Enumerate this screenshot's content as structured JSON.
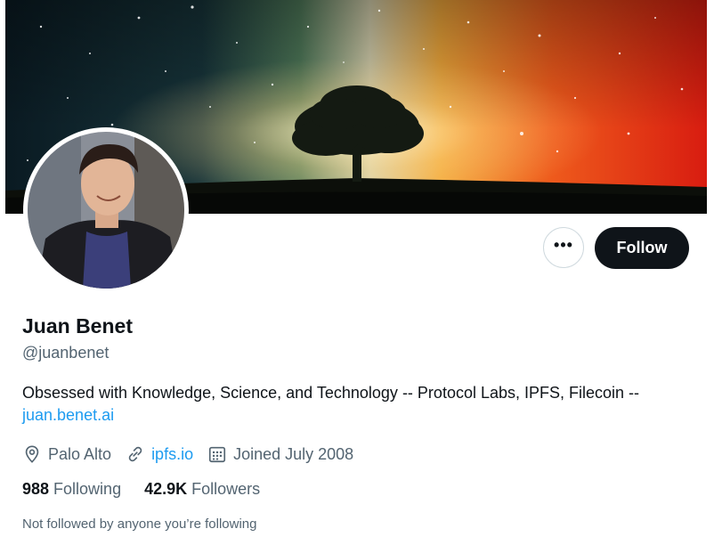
{
  "profile": {
    "name": "Juan Benet",
    "handle": "@juanbenet",
    "bio_text": "Obsessed with Knowledge, Science, and Technology -- Protocol Labs, IPFS, Filecoin -- ",
    "bio_link": "juan.benet.ai",
    "location": "Palo Alto",
    "website": "ipfs.io",
    "joined": "Joined July 2008"
  },
  "actions": {
    "more_label": "•••",
    "follow_label": "Follow"
  },
  "stats": {
    "following_count": "988",
    "following_label": "Following",
    "followers_count": "42.9K",
    "followers_label": "Followers"
  },
  "footer": {
    "not_followed": "Not followed by anyone you’re following"
  },
  "icons": {
    "location": "location-pin-icon",
    "website": "link-icon",
    "joined": "calendar-icon",
    "more": "more-dots-icon"
  },
  "colors": {
    "primary_text": "#0f1419",
    "secondary_text": "#536471",
    "link": "#1d9bf0",
    "button_dark": "#0f1419",
    "border": "#cfd9de"
  }
}
